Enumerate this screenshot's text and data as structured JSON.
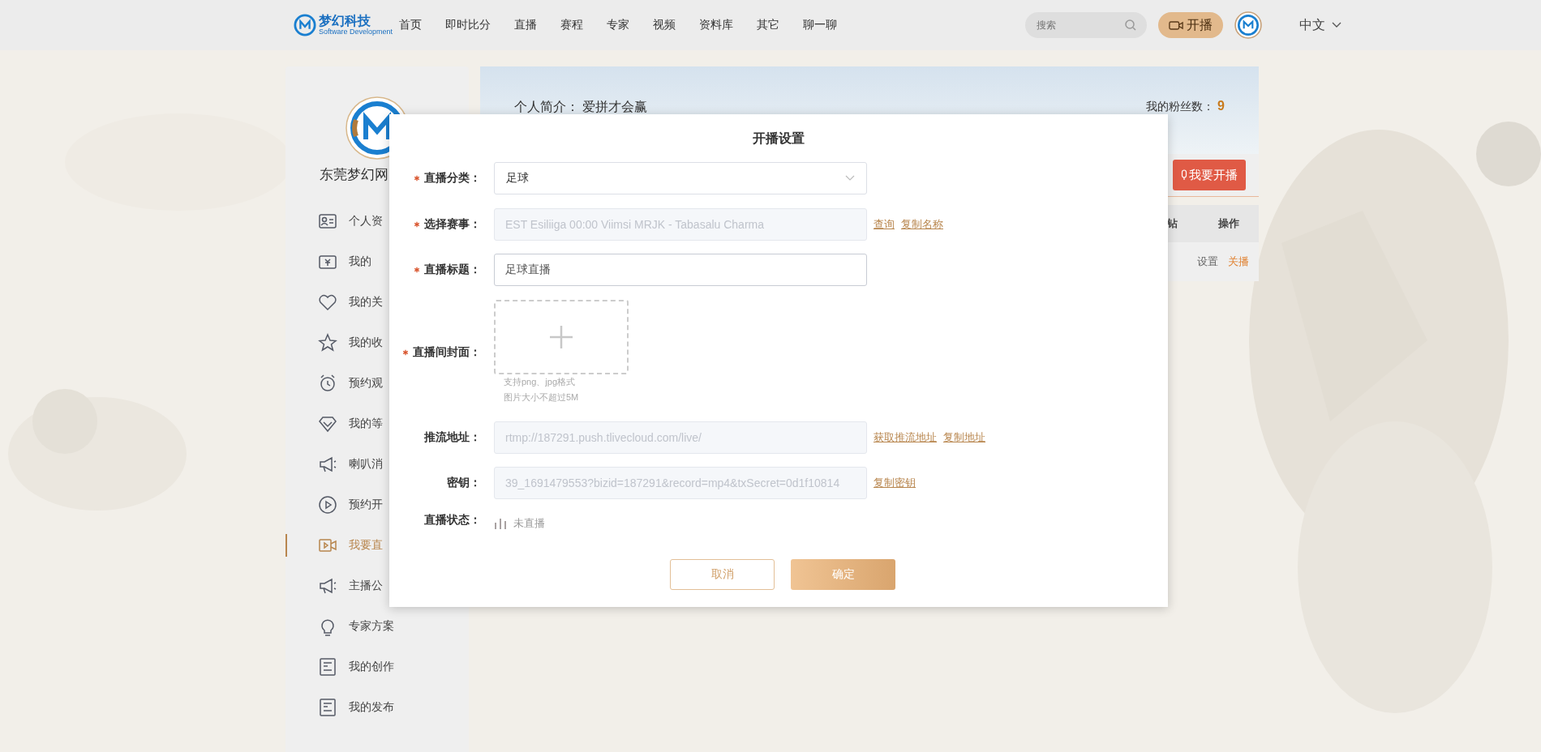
{
  "nav": {
    "logo_text": "梦幻科技",
    "logo_subtitle": "Software Development",
    "items": [
      "首页",
      "即时比分",
      "直播",
      "赛程",
      "专家",
      "视频",
      "资料库",
      "其它",
      "聊一聊"
    ],
    "search": {
      "placeholder": "搜索"
    },
    "live_button": "开播",
    "language": "中文"
  },
  "sidebar": {
    "title": "东莞梦幻网",
    "items": [
      {
        "label": "个人资",
        "selected": false
      },
      {
        "label": "我的",
        "selected": false
      },
      {
        "label": "我的关",
        "selected": false
      },
      {
        "label": "我的收",
        "selected": false
      },
      {
        "label": "预约观",
        "selected": false
      },
      {
        "label": "我的等",
        "selected": false
      },
      {
        "label": "喇叭消",
        "selected": false
      },
      {
        "label": "预约开",
        "selected": false
      },
      {
        "label": "我要直",
        "selected": true
      },
      {
        "label": "主播公",
        "selected": false
      },
      {
        "label": "专家方案",
        "selected": false
      },
      {
        "label": "我的创作",
        "selected": false
      },
      {
        "label": "我的发布",
        "selected": false
      }
    ]
  },
  "profile": {
    "bio_label": "个人简介：",
    "bio": "爱拼才会赢",
    "fans_label": "我的粉丝数：",
    "fans": "9",
    "start_button": "我要开播"
  },
  "table": {
    "columns": [
      "钻",
      "操作"
    ],
    "rows": [
      {
        "actions": [
          {
            "label": "设置",
            "kind": "neutral"
          },
          {
            "label": "关播",
            "kind": "danger"
          }
        ]
      }
    ]
  },
  "dialog": {
    "title": "开播设置",
    "fields": [
      {
        "kind": "select",
        "label": "直播分类：",
        "required": true,
        "value": "足球"
      },
      {
        "kind": "text",
        "label": "选择赛事：",
        "required": true,
        "disabled": true,
        "value": "EST Esiliiga 00:00 Viimsi MRJK - Tabasalu Charma",
        "links": [
          "查询",
          "复制名称"
        ]
      },
      {
        "kind": "text",
        "label": "直播标题：",
        "required": true,
        "disabled": false,
        "value": "足球直播"
      },
      {
        "kind": "upload",
        "label": "直播间封面：",
        "required": true,
        "hints": [
          "支持png、jpg格式",
          "图片大小不超过5M"
        ]
      },
      {
        "kind": "text",
        "label": "推流地址：",
        "required": false,
        "disabled": true,
        "value": "rtmp://187291.push.tlivecloud.com/live/",
        "links": [
          "获取推流地址",
          "复制地址"
        ]
      },
      {
        "kind": "text",
        "label": "密钥：",
        "required": false,
        "disabled": true,
        "value": "39_1691479553?bizid=187291&record=mp4&txSecret=0d1f10814",
        "links": [
          "复制密钥"
        ]
      },
      {
        "kind": "status",
        "label": "直播状态：",
        "required": false,
        "live": false,
        "value": "未直播"
      }
    ],
    "buttons": [
      {
        "label": "取消",
        "kind": "secondary"
      },
      {
        "label": "确定",
        "kind": "primary"
      }
    ]
  }
}
